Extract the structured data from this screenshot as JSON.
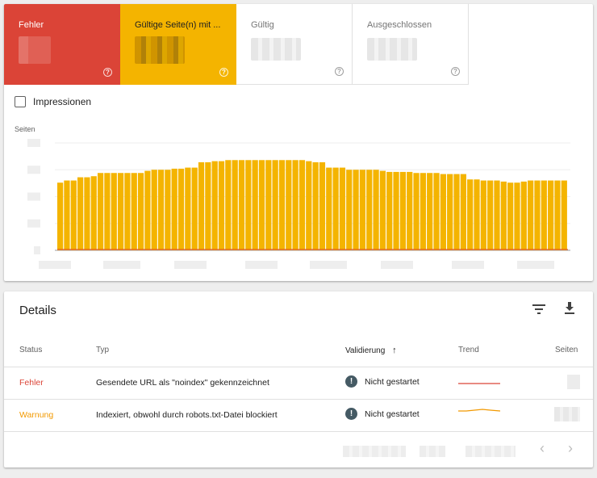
{
  "summary": {
    "error_label": "Fehler",
    "warning_label": "Gültige Seite(n) mit ...",
    "valid_label": "Gültig",
    "excluded_label": "Ausgeschlossen",
    "help_glyph": "?"
  },
  "impressions": {
    "label": "Impressionen",
    "checked": false
  },
  "chart_data": {
    "type": "bar",
    "ylabel": "Seiten",
    "bar_color": "#f4b400",
    "error_line_color": "#db4437",
    "values": [
      0.63,
      0.65,
      0.65,
      0.68,
      0.68,
      0.69,
      0.72,
      0.72,
      0.72,
      0.72,
      0.72,
      0.72,
      0.72,
      0.74,
      0.75,
      0.75,
      0.75,
      0.76,
      0.76,
      0.77,
      0.77,
      0.82,
      0.82,
      0.83,
      0.83,
      0.84,
      0.84,
      0.84,
      0.84,
      0.84,
      0.84,
      0.84,
      0.84,
      0.84,
      0.84,
      0.84,
      0.84,
      0.83,
      0.82,
      0.82,
      0.77,
      0.77,
      0.77,
      0.75,
      0.75,
      0.75,
      0.75,
      0.75,
      0.74,
      0.73,
      0.73,
      0.73,
      0.73,
      0.72,
      0.72,
      0.72,
      0.72,
      0.71,
      0.71,
      0.71,
      0.71,
      0.66,
      0.66,
      0.65,
      0.65,
      0.65,
      0.64,
      0.63,
      0.63,
      0.64,
      0.65,
      0.65,
      0.65,
      0.65,
      0.65,
      0.65
    ],
    "error_values_note": "",
    "ylim": [
      0,
      1
    ]
  },
  "details": {
    "title": "Details",
    "columns": {
      "status": "Status",
      "type": "Typ",
      "validation": "Validierung",
      "trend": "Trend",
      "pages": "Seiten"
    },
    "sort_arrow": "↑",
    "rows": [
      {
        "status": "Fehler",
        "type": "Gesendete URL als \"noindex\" gekennzeichnet",
        "validation": "Nicht gestartet",
        "trend_color": "#db4437"
      },
      {
        "status": "Warnung",
        "type": "Indexiert, obwohl durch robots.txt-Datei blockiert",
        "validation": "Nicht gestartet",
        "trend_color": "#f29900"
      }
    ],
    "alert_glyph": "!",
    "pager_prev": "‹",
    "pager_next": "›"
  },
  "colors": {
    "error": "#db4437",
    "warning": "#f4b400",
    "warning_text": "#f29900",
    "alert_icon": "#455a64"
  }
}
